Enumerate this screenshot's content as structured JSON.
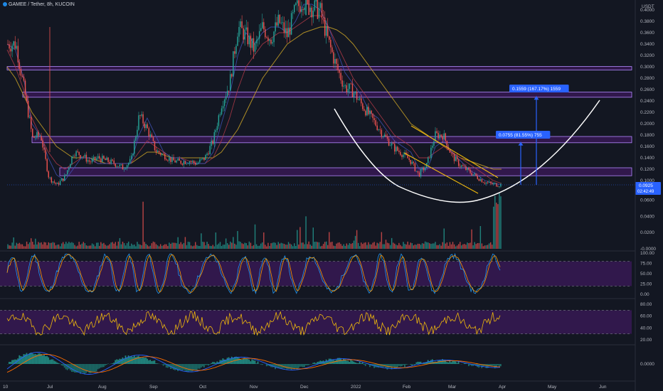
{
  "header": {
    "title": "GAMEE / Tether, 8h, KUCOIN",
    "unit": "USDT"
  },
  "colors": {
    "background": "#131722",
    "up": "#26a69a",
    "down": "#ef5350",
    "zone_fill": "#6a1b9a",
    "zone_border": "#b388ff",
    "curve": "#ffffff",
    "channel": "#f0b90b",
    "measure": "#2962ff",
    "price_label": "#2962ff",
    "stoch_k": "#2196f3",
    "stoch_d": "#ff9800",
    "rsi": "#f0b90b",
    "macd": "#2962ff",
    "signal": "#ff6d00"
  },
  "chart_data": {
    "type": "candlestick",
    "title": "GAMEE / Tether, 8h, KUCOIN",
    "price_axis": {
      "unit": "USDT",
      "ylim": [
        0.06,
        0.4
      ],
      "ticks": [
        "0.4000",
        "0.3800",
        "0.3600",
        "0.3400",
        "0.3200",
        "0.3000",
        "0.2800",
        "0.2600",
        "0.2400",
        "0.2200",
        "0.2000",
        "0.1800",
        "0.1600",
        "0.1400",
        "0.1200",
        "0.1000"
      ],
      "tick_values": [
        0.4,
        0.38,
        0.36,
        0.34,
        0.32,
        0.3,
        0.28,
        0.26,
        0.24,
        0.22,
        0.2,
        0.18,
        0.16,
        0.14,
        0.12,
        0.1
      ]
    },
    "time_axis": {
      "labels": [
        "10",
        "Jul",
        "Aug",
        "Sep",
        "Oct",
        "Nov",
        "Dec",
        "2022",
        "Feb",
        "Mar",
        "Apr",
        "May",
        "Jun"
      ]
    },
    "last_price": "0.0925",
    "countdown": "02:42:49",
    "resistance_zones": [
      [
        0.2945,
        0.3005
      ],
      [
        0.2465,
        0.2555
      ],
      [
        0.1665,
        0.1775
      ],
      [
        0.1085,
        0.1225
      ]
    ],
    "price_path": [
      [
        0.34,
        0.34
      ],
      [
        0.36,
        0.32
      ],
      [
        0.3,
        0.22
      ],
      [
        0.16,
        0.19
      ],
      [
        0.21,
        0.15
      ],
      [
        0.12,
        0.09
      ],
      [
        0.1,
        0.085
      ],
      [
        0.11,
        0.105
      ],
      [
        0.14,
        0.16
      ],
      [
        0.16,
        0.13
      ],
      [
        0.14,
        0.125
      ],
      [
        0.15,
        0.13
      ],
      [
        0.14,
        0.13
      ],
      [
        0.13,
        0.13
      ],
      [
        0.12,
        0.125
      ],
      [
        0.13,
        0.14
      ],
      [
        0.18,
        0.25
      ],
      [
        0.2,
        0.18
      ],
      [
        0.16,
        0.145
      ],
      [
        0.15,
        0.14
      ],
      [
        0.14,
        0.13
      ],
      [
        0.135,
        0.13
      ],
      [
        0.14,
        0.13
      ],
      [
        0.13,
        0.13
      ],
      [
        0.14,
        0.14
      ],
      [
        0.16,
        0.18
      ],
      [
        0.21,
        0.26
      ],
      [
        0.24,
        0.3
      ],
      [
        0.34,
        0.4
      ],
      [
        0.38,
        0.33
      ],
      [
        0.3,
        0.36
      ],
      [
        0.4,
        0.34
      ],
      [
        0.32,
        0.38
      ],
      [
        0.4,
        0.36
      ],
      [
        0.34,
        0.37
      ],
      [
        0.39,
        0.41
      ],
      [
        0.44,
        0.4
      ],
      [
        0.39,
        0.42
      ],
      [
        0.42,
        0.38
      ],
      [
        0.36,
        0.33
      ],
      [
        0.32,
        0.28
      ],
      [
        0.27,
        0.26
      ],
      [
        0.26,
        0.255
      ],
      [
        0.25,
        0.22
      ],
      [
        0.22,
        0.21
      ],
      [
        0.2,
        0.19
      ],
      [
        0.18,
        0.17
      ],
      [
        0.16,
        0.155
      ],
      [
        0.15,
        0.145
      ],
      [
        0.14,
        0.13
      ],
      [
        0.12,
        0.1
      ],
      [
        0.105,
        0.15
      ],
      [
        0.17,
        0.19
      ],
      [
        0.2,
        0.16
      ],
      [
        0.15,
        0.14
      ],
      [
        0.13,
        0.125
      ],
      [
        0.12,
        0.115
      ],
      [
        0.11,
        0.105
      ],
      [
        0.1,
        0.095
      ],
      [
        0.095,
        0.092
      ],
      [
        0.093,
        0.0925
      ]
    ],
    "overlays": {
      "ma_long": [
        0.3,
        0.28,
        0.25,
        0.22,
        0.2,
        0.18,
        0.16,
        0.15,
        0.14,
        0.14,
        0.14,
        0.135,
        0.13,
        0.13,
        0.13,
        0.13,
        0.14,
        0.15,
        0.15,
        0.145,
        0.14,
        0.14,
        0.14,
        0.14,
        0.14,
        0.14,
        0.15,
        0.17,
        0.19,
        0.22,
        0.25,
        0.28,
        0.3,
        0.32,
        0.34,
        0.35,
        0.36,
        0.365,
        0.37,
        0.37,
        0.365,
        0.355,
        0.34,
        0.32,
        0.3,
        0.28,
        0.26,
        0.24,
        0.22,
        0.2,
        0.19,
        0.18,
        0.17,
        0.16,
        0.15,
        0.14,
        0.135,
        0.13,
        0.125,
        0.12,
        0.12
      ],
      "ma_mid": [
        0.33,
        0.3,
        0.26,
        0.21,
        0.18,
        0.15,
        0.13,
        0.12,
        0.13,
        0.14,
        0.14,
        0.13,
        0.13,
        0.13,
        0.13,
        0.13,
        0.15,
        0.17,
        0.16,
        0.15,
        0.14,
        0.14,
        0.135,
        0.13,
        0.13,
        0.14,
        0.17,
        0.21,
        0.26,
        0.3,
        0.32,
        0.34,
        0.35,
        0.36,
        0.36,
        0.37,
        0.38,
        0.39,
        0.39,
        0.37,
        0.34,
        0.31,
        0.28,
        0.26,
        0.24,
        0.22,
        0.2,
        0.18,
        0.17,
        0.16,
        0.14,
        0.14,
        0.15,
        0.16,
        0.15,
        0.14,
        0.13,
        0.12,
        0.11,
        0.1,
        0.095
      ],
      "ma_short": [
        0.34,
        0.33,
        0.28,
        0.2,
        0.18,
        0.14,
        0.11,
        0.1,
        0.12,
        0.14,
        0.14,
        0.13,
        0.13,
        0.13,
        0.13,
        0.13,
        0.18,
        0.21,
        0.18,
        0.15,
        0.14,
        0.14,
        0.13,
        0.13,
        0.13,
        0.15,
        0.2,
        0.25,
        0.32,
        0.36,
        0.34,
        0.36,
        0.37,
        0.37,
        0.36,
        0.38,
        0.41,
        0.41,
        0.4,
        0.37,
        0.33,
        0.29,
        0.27,
        0.25,
        0.22,
        0.21,
        0.19,
        0.17,
        0.16,
        0.15,
        0.12,
        0.12,
        0.16,
        0.17,
        0.15,
        0.135,
        0.12,
        0.11,
        0.1,
        0.095,
        0.093
      ]
    },
    "annotations": [
      {
        "text": "0.1559 (167.17%) 1559",
        "x_index": 61.5,
        "from": 0.0925,
        "to": 0.2484
      },
      {
        "text": "0.0755 (81.55%) 755",
        "x_index": 59.5,
        "from": 0.0925,
        "to": 0.168
      }
    ],
    "volume_axis": {
      "ticks": [
        "0.0600",
        "0.0400",
        "0.0200",
        "-0.0000"
      ],
      "tick_values": [
        0.06,
        0.04,
        0.02,
        0.0
      ]
    },
    "stoch": {
      "ticks": [
        "100.00",
        "75.00",
        "50.00",
        "25.00",
        "0.00"
      ],
      "tick_values": [
        100,
        75,
        50,
        25,
        0
      ],
      "band": [
        20,
        80
      ]
    },
    "rsi": {
      "ticks": [
        "80.00",
        "60.00",
        "40.00",
        "20.00"
      ],
      "tick_values": [
        80,
        60,
        40,
        20
      ],
      "band": [
        30,
        70
      ]
    },
    "macd": {
      "ticks": [
        "0.0000"
      ],
      "tick_values": [
        0
      ]
    }
  }
}
